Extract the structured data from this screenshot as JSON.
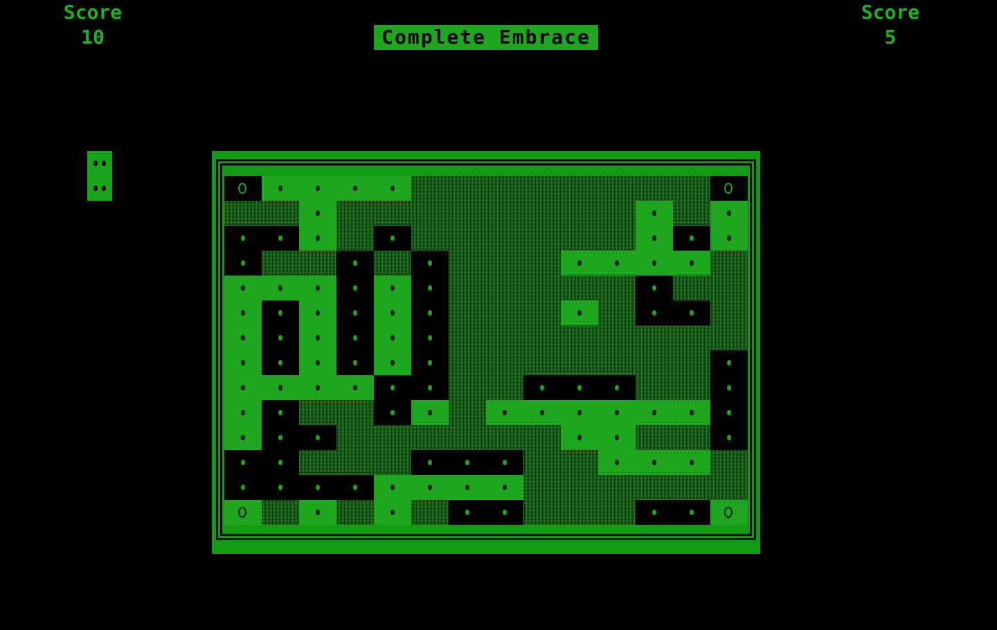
{
  "left_player": {
    "label": "Score",
    "value": "10"
  },
  "right_player": {
    "label": "Score",
    "value": "5"
  },
  "title": "Complete Embrace",
  "colors": {
    "bright": "#1fa51f",
    "frame": "#129a12",
    "dark": "#000000",
    "hatch": "#28a028"
  },
  "piece": {
    "pips": 4
  },
  "board": {
    "legend": {
      "G": "filled-cell",
      "D": "empty-cell",
      "H": "hatched-block",
      "lower-case": "contains pellet",
      "o/O": "power pellet"
    },
    "rows": [
      "oggggHHHHHHHHo",
      "HHgHHHHHHHHgHg",
      "ddgHdHHHHHHgdg",
      "dHHdHdHHHgggg",
      "gggdgdHHHHHdHH",
      "gdgdgdHHHgHdd",
      "gdgdgdHHHHHHHH",
      "gdgdgdHHHHHHHd",
      "ggggddHHdddHHd",
      "gdHHdgHggggggd",
      "gddHHHHHHggHHd",
      "ddHHHdddHHgggH",
      "ddddggggHHHHHH",
      "OHgHgHddHHHddO"
    ]
  }
}
